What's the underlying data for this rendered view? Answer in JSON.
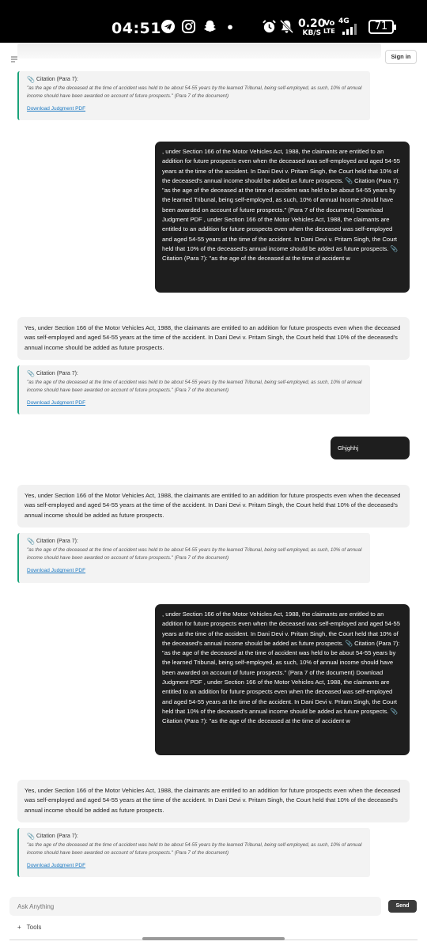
{
  "status_bar": {
    "time": "04:51",
    "speed_value": "0.20",
    "speed_unit": "KB/S",
    "volte_top": "Vo",
    "volte_bottom": "LTE",
    "network": "4G",
    "battery": "71",
    "icons": [
      "telegram-icon",
      "instagram-icon",
      "snapchat-icon",
      "dot-icon",
      "alarm-icon",
      "mute-icon",
      "signal-icon"
    ]
  },
  "header": {
    "menu_icon": "menu-icon",
    "signin_label": "Sign in"
  },
  "citation": {
    "title": "Citation (Para 7):",
    "quote": "\"as the age of the deceased at the time of accident was held to be about 54-55 years by the learned Tribunal, being self-employed, as such, 10% of annual income should have been awarded on account of future prospects.\" (Para 7 of the document)",
    "download_label": "Download Judgment PDF"
  },
  "messages": {
    "bot_answer": "Yes, under Section 166 of the Motor Vehicles Act, 1988, the claimants are entitled to an addition for future prospects even when the deceased was self-employed and aged 54-55 years at the time of the accident. In Dani Devi v. Pritam Singh, the Court held that 10% of the deceased's annual income should be added as future prospects.",
    "user_long_1": ", under Section 166 of the Motor Vehicles Act, 1988, the claimants are entitled to an addition for future prospects even when the deceased was self-employed and aged 54-55 years at the time of the accident. In Dani Devi v. Pritam Singh, the Court held that 10% of the deceased's annual income should be added as future prospects. 📎 Citation (Para 7): \"as the age of the deceased at the time of accident was held to be about 54-55 years by the learned Tribunal, being self-employed, as such, 10% of annual income should have been awarded on account of future prospects.\" (Para 7 of the document) Download Judgment PDF , under Section 166 of the Motor Vehicles Act, 1988, the claimants are entitled to an addition for future prospects even when the deceased was self-employed and aged 54-55 years at the time of the accident. In Dani Devi v. Pritam Singh, the Court held that 10% of the deceased's annual income should be added as future prospects. 📎 Citation (Para 7): \"as the age of the deceased at the time of accident w",
    "user_short": "Ghjghhj",
    "user_long_2": ", under Section 166 of the Motor Vehicles Act, 1988, the claimants are entitled to an addition for future prospects even when the deceased was self-employed and aged 54-55 years at the time of the accident. In Dani Devi v. Pritam Singh, the Court held that 10% of the deceased's annual income should be added as future prospects. 📎 Citation (Para 7): \"as the age of the deceased at the time of accident was held to be about 54-55 years by the learned Tribunal, being self-employed, as such, 10% of annual income should have been awarded on account of future prospects.\" (Para 7 of the document) Download Judgment PDF , under Section 166 of the Motor Vehicles Act, 1988, the claimants are entitled to an addition for future prospects even when the deceased was self-employed and aged 54-55 years at the time of the accident. In Dani Devi v. Pritam Singh, the Court held that 10% of the deceased's annual income should be added as future prospects. 📎 Citation (Para 7): \"as the age of the deceased at the time of accident w"
  },
  "composer": {
    "placeholder": "Ask Anything",
    "send_label": "Send",
    "tools_label": "Tools",
    "tools_icon": "plus-icon"
  }
}
